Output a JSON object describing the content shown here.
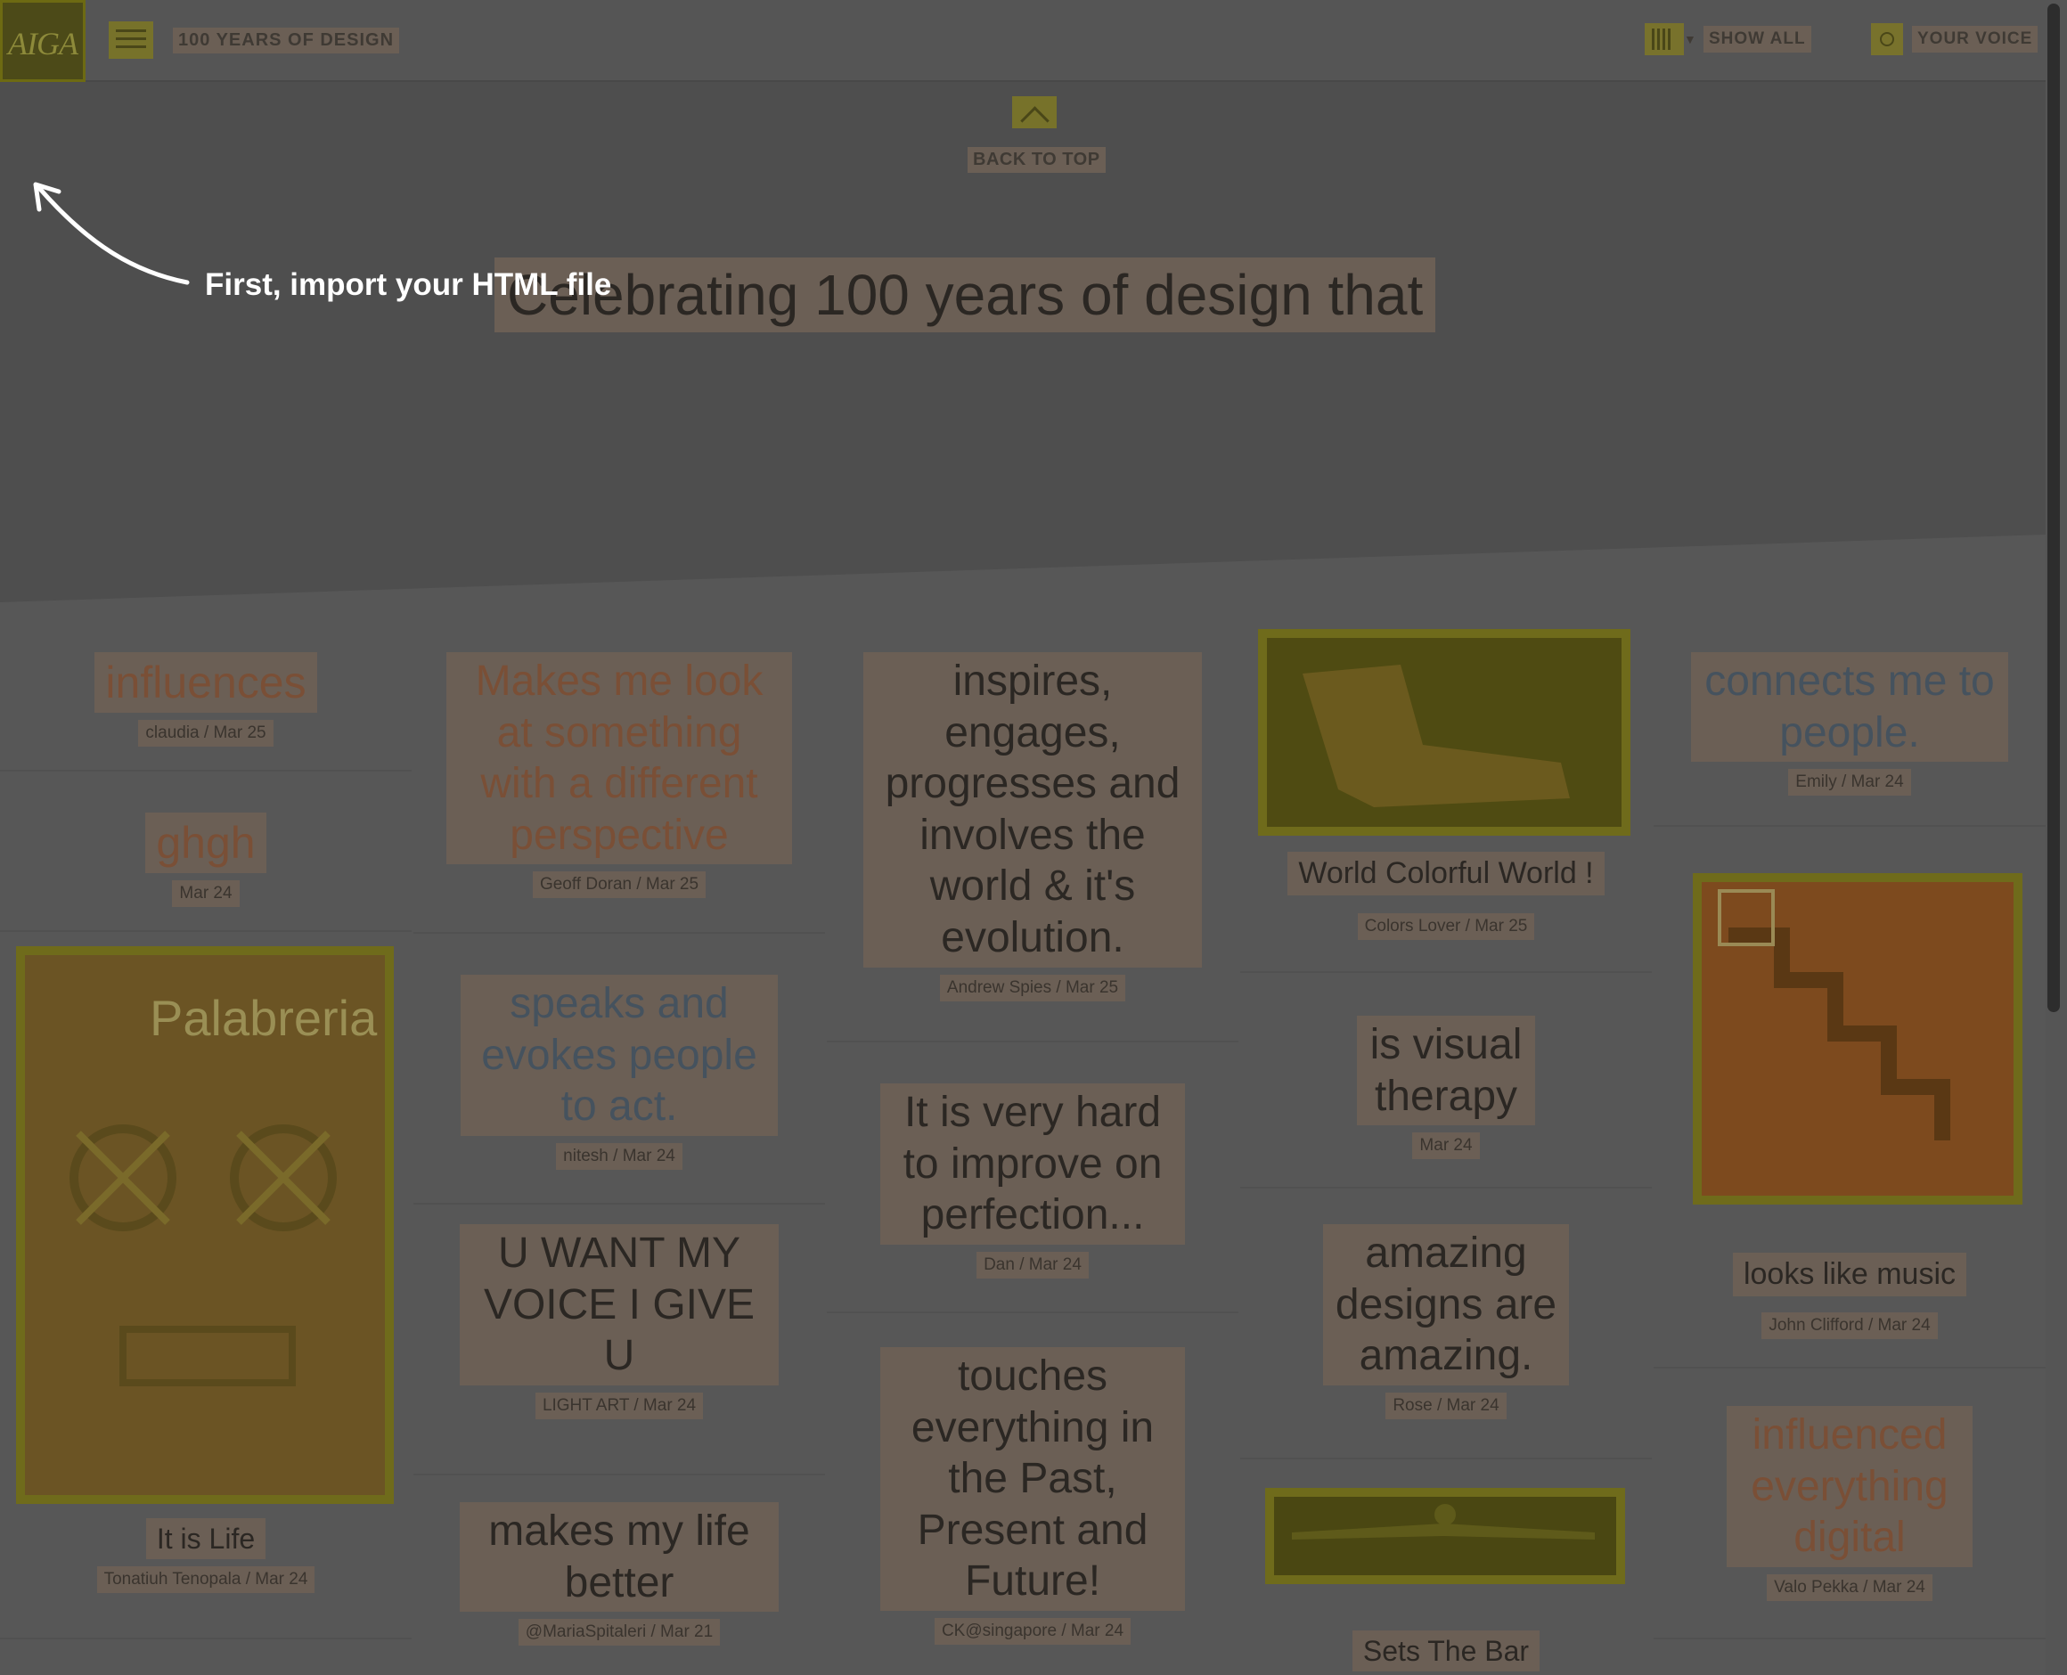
{
  "header": {
    "logo": "AIGA",
    "site_title": "100 YEARS OF DESIGN",
    "show_all": "SHOW ALL",
    "your_voice": "YOUR VOICE"
  },
  "hero": {
    "back_to_top": "BACK TO TOP",
    "headline": "Celebrating 100 years of design that"
  },
  "tooltip": {
    "text": "First, import your HTML file"
  },
  "cards": [
    {
      "id": "c1",
      "quote": "influences",
      "meta": "claudia / Mar 25"
    },
    {
      "id": "c2",
      "quote": "ghgh",
      "meta": "Mar 24"
    },
    {
      "id": "c3",
      "quote": "It is Life",
      "meta": "Tonatiuh Tenopala / Mar 24",
      "image_alt": "Palabreria"
    },
    {
      "id": "c4",
      "quote": "Makes me look at something with a different perspective",
      "meta": "Geoff Doran / Mar 25"
    },
    {
      "id": "c5",
      "quote": "speaks and evokes people to act.",
      "meta": "nitesh / Mar 24"
    },
    {
      "id": "c6",
      "quote": "U WANT MY VOICE I GIVE U",
      "meta": "LIGHT ART / Mar 24"
    },
    {
      "id": "c7",
      "quote": "makes my life better",
      "meta": "@MariaSpitaleri / Mar 21"
    },
    {
      "id": "c8",
      "quote": "inspires, engages, progresses and involves the world & it's evolution.",
      "meta": "Andrew Spies / Mar 25"
    },
    {
      "id": "c9",
      "quote": "It is very hard to improve on perfection...",
      "meta": "Dan / Mar 24"
    },
    {
      "id": "c10",
      "quote": "touches everything in the Past, Present and Future!",
      "meta": "CK@singapore / Mar 24"
    },
    {
      "id": "c11",
      "quote": "World Colorful World !",
      "meta": "Colors Lover / Mar 25"
    },
    {
      "id": "c12",
      "quote": "is visual therapy",
      "meta": "Mar 24"
    },
    {
      "id": "c13",
      "quote": "amazing designs are amazing.",
      "meta": "Rose / Mar 24"
    },
    {
      "id": "c14",
      "quote": "Sets The Bar",
      "meta": ""
    },
    {
      "id": "c15",
      "quote": "connects me to people.",
      "meta": "Emily / Mar 24"
    },
    {
      "id": "c16",
      "quote": "looks like music",
      "meta": "John Clifford / Mar 24"
    },
    {
      "id": "c17",
      "quote": "influenced everything digital",
      "meta": "Valo Pekka / Mar 24"
    }
  ],
  "colors": {
    "overlay_bg": "#4e4e4e",
    "highlight_text_bg": "#6b5f55",
    "highlight_element_bg": "#77722a",
    "tooltip_text": "#ffffff"
  }
}
